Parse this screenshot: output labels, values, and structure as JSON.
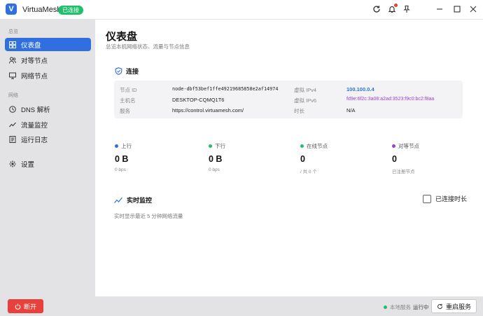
{
  "titlebar": {
    "logo_letter": "V",
    "app_name": "VirtuaMesh",
    "status_badge": "已连接"
  },
  "sidebar": {
    "section_overview": "总览",
    "section_network": "网络",
    "items": [
      {
        "label": "仪表盘",
        "icon": "dashboard-icon",
        "active": true
      },
      {
        "label": "对等节点",
        "icon": "users-icon"
      },
      {
        "label": "网络节点",
        "icon": "monitor-icon"
      },
      {
        "label": "DNS 解析",
        "icon": "dns-icon"
      },
      {
        "label": "流量监控",
        "icon": "chart-icon"
      },
      {
        "label": "运行日志",
        "icon": "log-icon"
      },
      {
        "label": "设置",
        "icon": "gear-icon"
      }
    ]
  },
  "main": {
    "title": "仪表盘",
    "subtitle": "总览本机网络状态、流量与节点信息",
    "connection": {
      "heading": "连接",
      "node_id_label": "节点 ID",
      "node_id": "node-dbf53bef1ffe49219685858e2af14974",
      "host_label": "主机名",
      "host": "DESKTOP-CQMQ1T6",
      "server_label": "服务",
      "server": "https://control.virtuamesh.com/",
      "ipv4_label": "虚拟 IPv4",
      "ipv4": "100.100.0.4",
      "ipv6_label": "虚拟 IPv6",
      "ipv6": "fd9e:6f2c:3a08:a2ad:3523:f9c0:bc2:f8aa",
      "duration_label": "时长",
      "duration": "N/A"
    },
    "stats": [
      {
        "label": "上行",
        "value": "0 B",
        "sub": "0 bps",
        "color": "#2f6fe0"
      },
      {
        "label": "下行",
        "value": "0 B",
        "sub": "0 bps",
        "color": "#1fbf6c"
      },
      {
        "label": "在线节点",
        "value": "0",
        "sub": "/ 共 0 个",
        "color": "#1fbf6c"
      },
      {
        "label": "对等节点",
        "value": "0",
        "sub": "已注册节点",
        "color": "#9b3fd6"
      }
    ],
    "monitor": {
      "heading": "实时监控",
      "description": "实时显示最近 5 分钟网络流量",
      "checkbox_label": "已连接时长"
    }
  },
  "bottombar": {
    "stop_label": "断开",
    "service_label": "本地服务",
    "service_state": "运行中",
    "restart_label": "重启服务"
  },
  "colors": {
    "accent": "#2f6fe0",
    "success": "#1fbf6c",
    "danger": "#e8403a",
    "purple": "#9b3fd6"
  }
}
